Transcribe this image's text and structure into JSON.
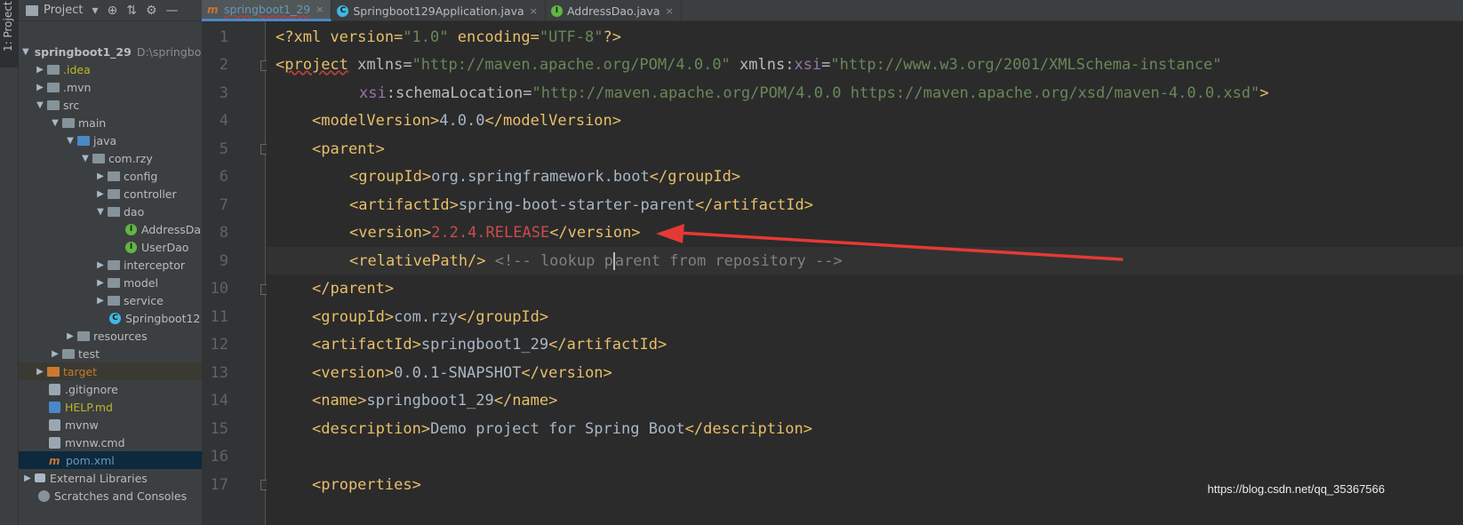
{
  "sidebar_strip_label": "1: Project",
  "project_panel": {
    "title": "Project",
    "items": [
      {
        "label": "springboot1_29",
        "path": "D:\\springboo"
      },
      {
        "label": ".idea"
      },
      {
        "label": ".mvn"
      },
      {
        "label": "src"
      },
      {
        "label": "main"
      },
      {
        "label": "java"
      },
      {
        "label": "com.rzy"
      },
      {
        "label": "config"
      },
      {
        "label": "controller"
      },
      {
        "label": "dao"
      },
      {
        "label": "AddressDa"
      },
      {
        "label": "UserDao"
      },
      {
        "label": "interceptor"
      },
      {
        "label": "model"
      },
      {
        "label": "service"
      },
      {
        "label": "Springboot12"
      },
      {
        "label": "resources"
      },
      {
        "label": "test"
      },
      {
        "label": "target"
      },
      {
        "label": ".gitignore"
      },
      {
        "label": "HELP.md"
      },
      {
        "label": "mvnw"
      },
      {
        "label": "mvnw.cmd"
      },
      {
        "label": "pom.xml"
      },
      {
        "label": "External Libraries"
      },
      {
        "label": "Scratches and Consoles"
      }
    ]
  },
  "tabs": [
    {
      "label": "springboot1_29",
      "active": true
    },
    {
      "label": "Springboot129Application.java"
    },
    {
      "label": "AddressDao.java"
    }
  ],
  "line_numbers": [
    "1",
    "2",
    "3",
    "4",
    "5",
    "6",
    "7",
    "8",
    "9",
    "10",
    "11",
    "12",
    "13",
    "14",
    "15",
    "16",
    "17"
  ],
  "code": {
    "l1": {
      "a": "<?xml version=",
      "b": "\"1.0\"",
      "c": " encoding=",
      "d": "\"UTF-8\"",
      "e": "?>"
    },
    "l2": {
      "a": "<",
      "b": "project",
      "c": " xmlns=",
      "d": "\"http://maven.apache.org/POM/4.0.0\"",
      "e": " xmlns:",
      "f": "xsi",
      "g": "=",
      "h": "\"http://www.w3.org/2001/XMLSchema-instance\""
    },
    "l3": {
      "a": "xsi",
      "b": ":schemaLocation=",
      "c": "\"http://maven.apache.org/POM/4.0.0 https://maven.apache.org/xsd/maven-4.0.0.xsd\"",
      "d": ">"
    },
    "l4": {
      "a": "<modelVersion>",
      "b": "4.0.0",
      "c": "</modelVersion>"
    },
    "l5": {
      "a": "<parent>"
    },
    "l6": {
      "a": "<groupId>",
      "b": "org.springframework.boot",
      "c": "</groupId>"
    },
    "l7": {
      "a": "<artifactId>",
      "b": "spring-boot-starter-parent",
      "c": "</artifactId>"
    },
    "l8": {
      "a": "<version>",
      "b": "2.2.4.RELEASE",
      "c": "</version>"
    },
    "l9": {
      "a": "<relativePath/>",
      "b": " <!-- lookup p",
      "c": "arent from repository -->"
    },
    "l10": {
      "a": "</parent>"
    },
    "l11": {
      "a": "<groupId>",
      "b": "com.rzy",
      "c": "</groupId>"
    },
    "l12": {
      "a": "<artifactId>",
      "b": "springboot1_29",
      "c": "</artifactId>"
    },
    "l13": {
      "a": "<version>",
      "b": "0.0.1-SNAPSHOT",
      "c": "</version>"
    },
    "l14": {
      "a": "<name>",
      "b": "springboot1_29",
      "c": "</name>"
    },
    "l15": {
      "a": "<description>",
      "b": "Demo project for Spring Boot",
      "c": "</description>"
    },
    "l17": {
      "a": "<properties>"
    }
  },
  "colors": {
    "annotation_arrow": "#e53935",
    "tag": "#e8bf6a",
    "attr_value": "#6a8759",
    "highlight_text": "#cc4b4b"
  },
  "watermark": "https://blog.csdn.net/qq_35367566"
}
